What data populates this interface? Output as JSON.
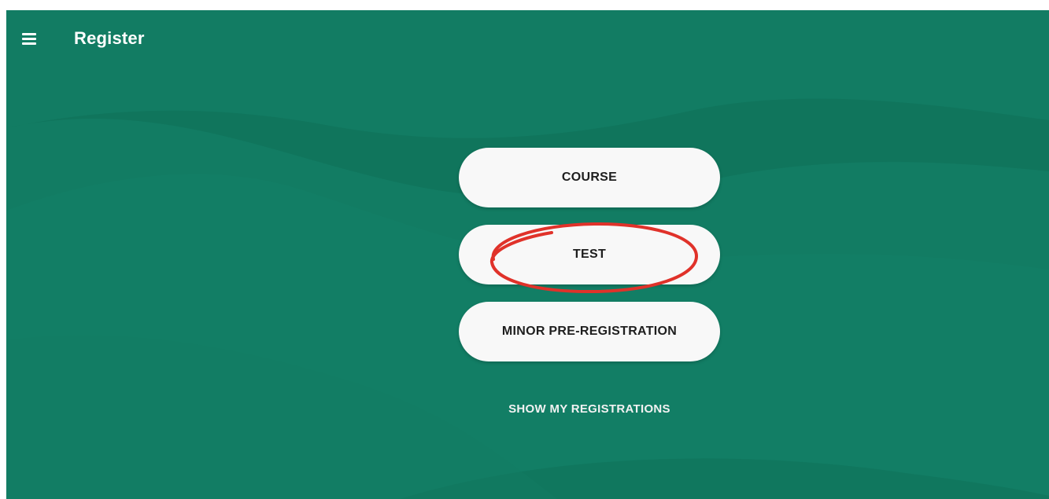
{
  "app_bar": {
    "menu_icon": "hamburger-menu-icon",
    "title": "Register"
  },
  "register_options": [
    {
      "label": "COURSE"
    },
    {
      "label": "TEST"
    },
    {
      "label": "MINOR PRE-REGISTRATION"
    }
  ],
  "show_registrations_label": "SHOW MY REGISTRATIONS",
  "colors": {
    "background": "#127c63",
    "button_bg": "#f8f8f8",
    "button_text": "#1e1e1e",
    "annotation": "#e0322a"
  }
}
